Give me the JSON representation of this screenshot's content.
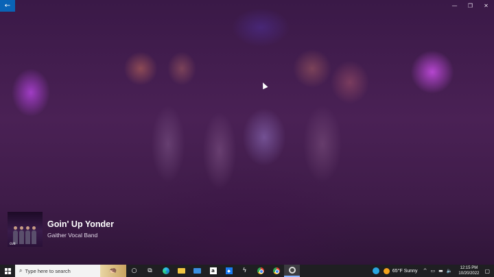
{
  "window": {
    "back_icon": "←",
    "controls": [
      {
        "name": "minimize-button",
        "glyph": "—"
      },
      {
        "name": "restore-button",
        "glyph": "❐"
      },
      {
        "name": "close-button",
        "glyph": "✕"
      }
    ]
  },
  "now_playing": {
    "title": "Goin' Up Yonder",
    "artist": "Gaither Vocal Band",
    "album_logo": "GVB"
  },
  "taskbar": {
    "search_placeholder": "Type here to search",
    "search_icon": "⌕",
    "cortana_icon": "○",
    "taskview_icon": "⧉",
    "apps": [
      "edge",
      "file-explorer",
      "mail",
      "amazon",
      "dropbox",
      "unknown",
      "chrome",
      "chrome",
      "groove-music"
    ],
    "weather": "65°F  Sunny",
    "time": "12:15 PM",
    "date": "10/20/2022"
  },
  "colors": {
    "back_button": "#0a63b6",
    "taskbar": "#1f1f22"
  }
}
